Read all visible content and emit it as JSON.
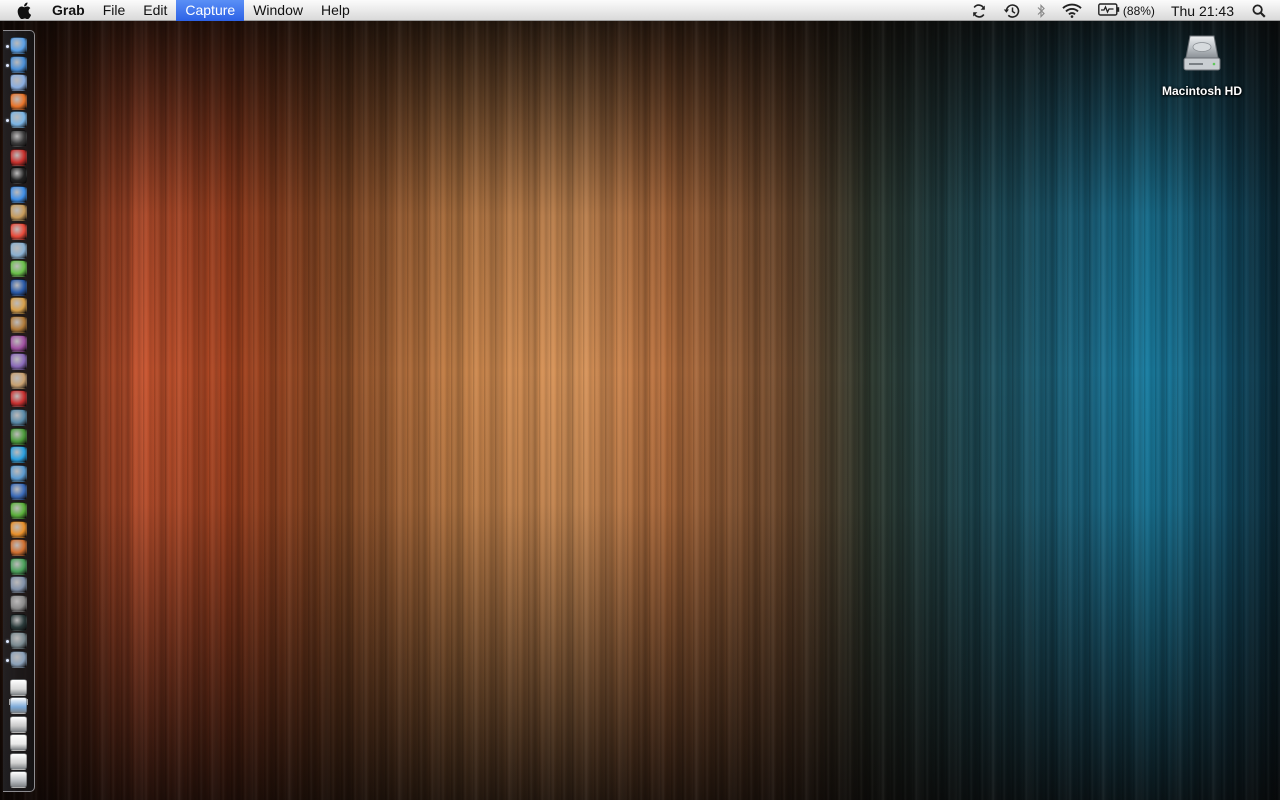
{
  "menubar": {
    "apple_icon": "apple-icon",
    "app_name": "Grab",
    "menus": [
      "File",
      "Edit",
      "Capture",
      "Window",
      "Help"
    ],
    "active_menu": "Capture",
    "status": {
      "icons": [
        "sync-icon",
        "time-machine-icon",
        "bluetooth-icon",
        "wifi-icon",
        "battery-icon",
        "spotlight-icon"
      ],
      "battery_percent": "(88%)",
      "clock": "Thu 21:43"
    }
  },
  "desktop": {
    "icons": [
      {
        "label": "Macintosh HD",
        "icon": "hard-drive-icon"
      }
    ]
  },
  "dock": {
    "orientation": "left",
    "apps": [
      {
        "name": "finder-icon",
        "color": "#5aa0e8",
        "running": true
      },
      {
        "name": "safari-icon",
        "color": "#4a8fd8",
        "running": true
      },
      {
        "name": "mail-icon",
        "color": "#8aaee0",
        "running": false
      },
      {
        "name": "firefox-icon",
        "color": "#e8742a",
        "running": false
      },
      {
        "name": "itunes-icon",
        "color": "#7ab4e4",
        "running": true
      },
      {
        "name": "dashboard-icon",
        "color": "#3a3a3a",
        "running": false
      },
      {
        "name": "youtube-icon",
        "color": "#c8302c",
        "running": false
      },
      {
        "name": "quill-icon",
        "color": "#222222",
        "running": false
      },
      {
        "name": "ichat-icon",
        "color": "#3f8ee6",
        "running": false
      },
      {
        "name": "address-book-icon",
        "color": "#c69a5a",
        "running": false
      },
      {
        "name": "ical-icon",
        "color": "#e84a3a",
        "running": false
      },
      {
        "name": "preview-icon",
        "color": "#8ab0d0",
        "running": false
      },
      {
        "name": "picasa-icon",
        "color": "#6ac04a",
        "running": false
      },
      {
        "name": "google-earth-icon",
        "color": "#2a5aa8",
        "running": false
      },
      {
        "name": "iphoto-icon",
        "color": "#d8a04a",
        "running": false
      },
      {
        "name": "pixelmator-icon",
        "color": "#b07a3a",
        "running": false
      },
      {
        "name": "photo-booth-icon",
        "color": "#a050a0",
        "running": false
      },
      {
        "name": "imovie-icon",
        "color": "#8a6ab8",
        "running": false
      },
      {
        "name": "garageband-icon",
        "color": "#c8a070",
        "running": false
      },
      {
        "name": "flashcards-icon",
        "color": "#c83030",
        "running": false
      },
      {
        "name": "dvd-player-icon",
        "color": "#5a8aa8",
        "running": false
      },
      {
        "name": "adium-icon",
        "color": "#4a9a3a",
        "running": false
      },
      {
        "name": "skype-icon",
        "color": "#2aa0e0",
        "running": false
      },
      {
        "name": "messenger-icon",
        "color": "#5a9ad0",
        "running": false
      },
      {
        "name": "word-icon",
        "color": "#3a6ab8",
        "running": false
      },
      {
        "name": "bamboo-icon",
        "color": "#5ab03a",
        "running": false
      },
      {
        "name": "pages-icon",
        "color": "#e8902a",
        "running": false
      },
      {
        "name": "keynote-icon",
        "color": "#d07030",
        "running": false
      },
      {
        "name": "numbers-icon",
        "color": "#4aa05a",
        "running": false
      },
      {
        "name": "script-editor-icon",
        "color": "#8090a8",
        "running": false
      },
      {
        "name": "system-preferences-icon",
        "color": "#8a8a8a",
        "running": false
      },
      {
        "name": "activity-monitor-icon",
        "color": "#2a3a3a",
        "running": false
      },
      {
        "name": "grab-icon",
        "color": "#7a8a90",
        "running": true
      },
      {
        "name": "preview-document-icon",
        "color": "#8aa0b8",
        "running": true
      }
    ],
    "stacks": [
      {
        "name": "applications-stack-icon",
        "color": "#d8d8d8"
      },
      {
        "name": "documents-folder-icon",
        "color": "#7aa8d8"
      },
      {
        "name": "downloads-stack-icon",
        "color": "#c8c8c8"
      },
      {
        "name": "mail-stack-icon",
        "color": "#e8e8e8"
      },
      {
        "name": "screenshots-stack-icon",
        "color": "#d0d0d0"
      },
      {
        "name": "trash-icon",
        "color": "#b8bcc0"
      }
    ]
  }
}
